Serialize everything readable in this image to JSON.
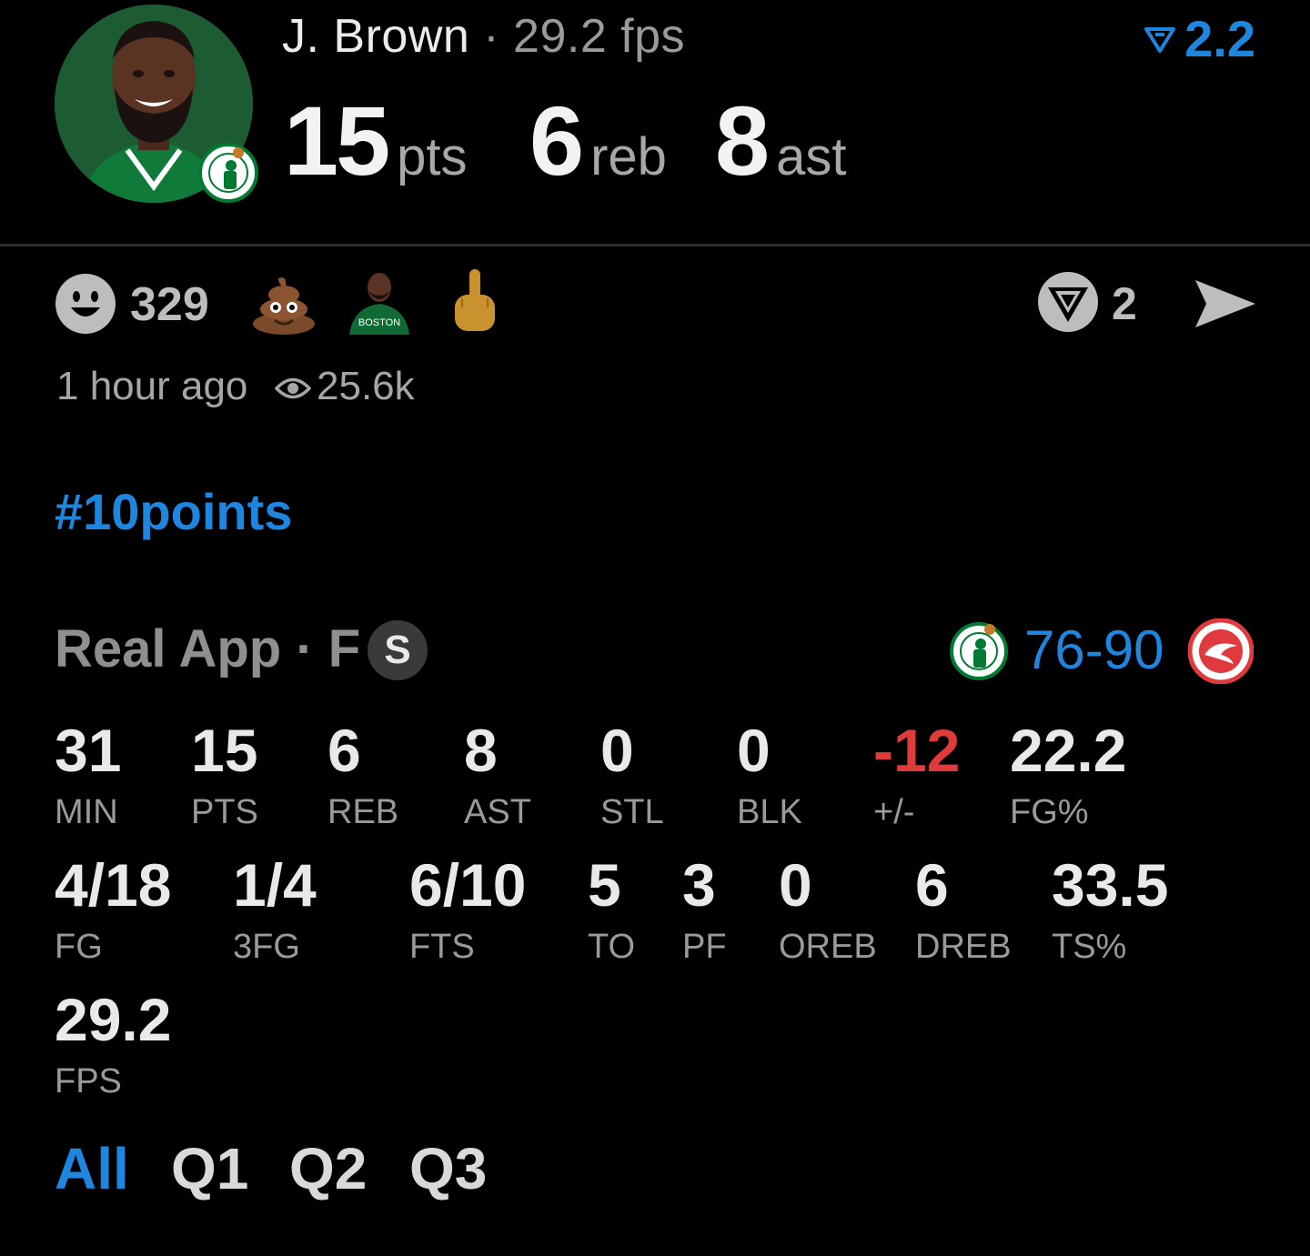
{
  "player": {
    "name": "J. Brown",
    "separator": "·",
    "fps_label": "29.2 fps",
    "trend_value": "2.2",
    "big_stats": [
      {
        "value": "15",
        "unit": "pts"
      },
      {
        "value": "6",
        "unit": "reb"
      },
      {
        "value": "8",
        "unit": "ast"
      }
    ]
  },
  "reactions": {
    "count": "329",
    "emojis": [
      "poop-emoji",
      "player-emoji",
      "middle-finger-emoji"
    ],
    "vote_count": "2",
    "time_ago": "1 hour ago",
    "views": "25.6k"
  },
  "hashtag": "#10points",
  "game": {
    "label": "Real App · F",
    "status_badge": "S",
    "score": "76-90",
    "colors": {
      "accent": "#1f86e0",
      "negative": "#e03a3a",
      "celtics": "#007a33",
      "hawks": "#e03a3e"
    }
  },
  "stats_row1": [
    {
      "value": "31",
      "label": "MIN"
    },
    {
      "value": "15",
      "label": "PTS"
    },
    {
      "value": "6",
      "label": "REB"
    },
    {
      "value": "8",
      "label": "AST"
    },
    {
      "value": "0",
      "label": "STL"
    },
    {
      "value": "0",
      "label": "BLK"
    },
    {
      "value": "-12",
      "label": "+/-"
    },
    {
      "value": "22.2",
      "label": "FG%"
    }
  ],
  "stats_row2": [
    {
      "value": "4/18",
      "label": "FG"
    },
    {
      "value": "1/4",
      "label": "3FG"
    },
    {
      "value": "6/10",
      "label": "FTS"
    },
    {
      "value": "5",
      "label": "TO"
    },
    {
      "value": "3",
      "label": "PF"
    },
    {
      "value": "0",
      "label": "OREB"
    },
    {
      "value": "6",
      "label": "DREB"
    },
    {
      "value": "33.5",
      "label": "TS%"
    }
  ],
  "stats_row3": [
    {
      "value": "29.2",
      "label": "FPS"
    }
  ],
  "tabs": [
    "All",
    "Q1",
    "Q2",
    "Q3"
  ],
  "active_tab": "All"
}
